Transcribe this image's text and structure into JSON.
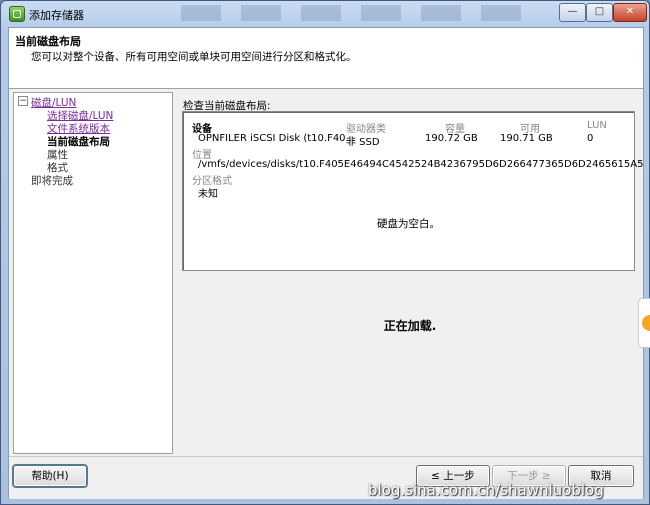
{
  "window": {
    "title": "添加存储器",
    "controls": {
      "minimize": "—",
      "maximize": "□",
      "close": "✕"
    }
  },
  "header": {
    "title": "当前磁盘布局",
    "description": "您可以对整个设备、所有可用空间或单块可用空间进行分区和格式化。"
  },
  "nav": {
    "toggle": "−",
    "items": [
      {
        "label": "磁盘/LUN",
        "state": "link"
      },
      {
        "label": "选择磁盘/LUN",
        "state": "link"
      },
      {
        "label": "文件系统版本",
        "state": "link"
      },
      {
        "label": "当前磁盘布局",
        "state": "current"
      },
      {
        "label": "属性",
        "state": "plain"
      },
      {
        "label": "格式",
        "state": "plain"
      },
      {
        "label": "即将完成",
        "state": "plain"
      }
    ]
  },
  "layout": {
    "label": "检查当前磁盘布局:",
    "columns": [
      "设备",
      "驱动器类",
      "容量",
      "可用",
      "LUN"
    ],
    "device": {
      "name": "OPNFILER iSCSI Disk (t10.F40...",
      "drive_type": "非 SSD",
      "capacity": "190.72 GB",
      "available": "190.71 GB",
      "lun": "0"
    },
    "location_label": "位置",
    "location_value": "/vmfs/devices/disks/t10.F405E46494C4542524B4236795D6D266477365D6D2465615A5",
    "partition_label": "分区格式",
    "partition_value": "未知",
    "empty_message": "硬盘为空白。"
  },
  "status": {
    "loading": "正在加载."
  },
  "footer": {
    "help": "帮助(H)",
    "back": "≤ 上一步",
    "next": "下一步 ≥",
    "cancel": "取消"
  },
  "watermark": "blog.sina.com.cn/shawnluoblog"
}
